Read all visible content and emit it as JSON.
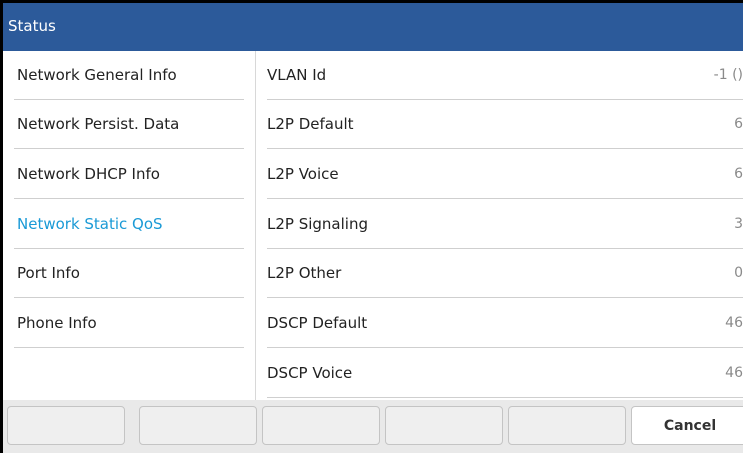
{
  "window": {
    "title": "Status"
  },
  "sidebar": {
    "items": [
      {
        "label": "Network General Info",
        "active": false
      },
      {
        "label": "Network Persist. Data",
        "active": false
      },
      {
        "label": "Network DHCP Info",
        "active": false
      },
      {
        "label": "Network Static QoS",
        "active": true
      },
      {
        "label": "Port Info",
        "active": false
      },
      {
        "label": "Phone Info",
        "active": false
      }
    ],
    "active_color": "#1a9ad6"
  },
  "details": {
    "rows": [
      {
        "key": "VLAN Id",
        "value": "-1 ()"
      },
      {
        "key": "L2P Default",
        "value": "6"
      },
      {
        "key": "L2P Voice",
        "value": "6"
      },
      {
        "key": "L2P Signaling",
        "value": "3"
      },
      {
        "key": "L2P Other",
        "value": "0"
      },
      {
        "key": "DSCP Default",
        "value": "46"
      },
      {
        "key": "DSCP Voice",
        "value": "46"
      }
    ]
  },
  "softkeys": {
    "keys": [
      {
        "label": ""
      },
      {
        "label": ""
      },
      {
        "label": ""
      },
      {
        "label": ""
      },
      {
        "label": ""
      },
      {
        "label": "Cancel"
      }
    ]
  },
  "colors": {
    "titlebar": "#2c5a9a",
    "text": "#222222",
    "value_text": "#8a8a8a"
  }
}
